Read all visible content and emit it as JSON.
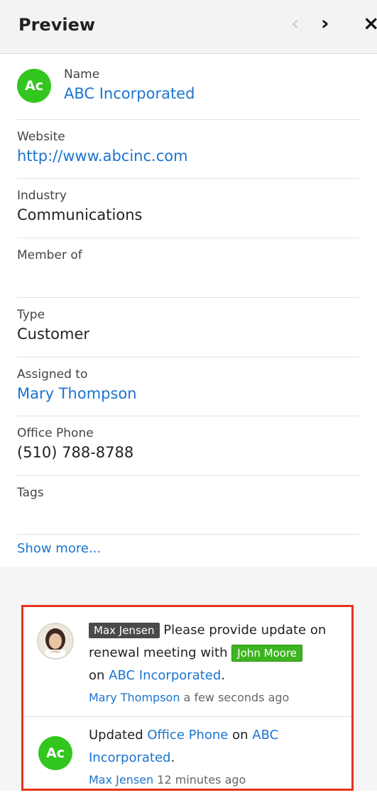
{
  "header": {
    "title": "Preview",
    "prev": "‹",
    "next": "›",
    "close": "×"
  },
  "record": {
    "avatar_initials": "Ac",
    "name_label": "Name",
    "name_value": "ABC Incorporated",
    "website_label": "Website",
    "website_value": "http://www.abcinc.com",
    "industry_label": "Industry",
    "industry_value": "Communications",
    "member_label": "Member of",
    "member_value": "",
    "type_label": "Type",
    "type_value": "Customer",
    "assigned_label": "Assigned to",
    "assigned_value": "Mary Thompson",
    "phone_label": "Office Phone",
    "phone_value": "(510) 788-8788",
    "tags_label": "Tags",
    "tags_value": "",
    "show_more": "Show more..."
  },
  "activity": {
    "item1": {
      "mention": "Max Jensen",
      "text1": "Please provide update on renewal meeting with",
      "mention2": "John Moore",
      "text2": "on",
      "record_link": "ABC Incorporated",
      "period": ".",
      "author": "Mary Thompson",
      "time": "a few seconds ago"
    },
    "item2": {
      "avatar_initials": "Ac",
      "text1": "Updated",
      "field_link": "Office Phone",
      "text2": "on",
      "record_link": "ABC Incorporated",
      "period": ".",
      "author": "Max Jensen",
      "time": "12 minutes ago"
    }
  },
  "colors": {
    "accent": "#1b74cf",
    "avatar_green": "#32c61e",
    "highlight_border": "#e8321b"
  }
}
